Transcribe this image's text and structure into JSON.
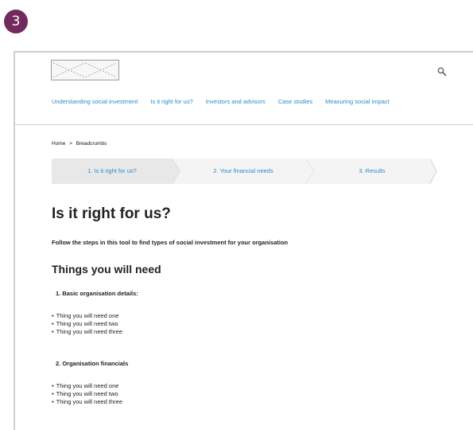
{
  "badge": {
    "number": "3",
    "color": "#722a5e"
  },
  "header": {
    "logo": "logo-placeholder",
    "search_icon": "search-icon"
  },
  "nav": {
    "items": [
      "Understanding social investment",
      "Is it right for us?",
      "Investors and advisors",
      "Case studies",
      "Measuring social impact"
    ]
  },
  "breadcrumb": {
    "home": "Home",
    "separator": ">",
    "current": "Breadcrumbs"
  },
  "stepper": {
    "steps": [
      {
        "label": "1. Is it right for us?",
        "active": true
      },
      {
        "label": "2. Your financial needs",
        "active": false
      },
      {
        "label": "3. Results",
        "active": false
      }
    ]
  },
  "main": {
    "title": "Is it right for us?",
    "intro": "Follow the steps in this tool to find types of social investment for your organisation",
    "section_title": "Things you will need",
    "groups": [
      {
        "title": "1.  Basic organisation details:",
        "items": [
          "Thing you will need one",
          "Thing you will need two",
          "Thing you will need three"
        ]
      },
      {
        "title": "2.  Organisation financials",
        "items": [
          "Thing you will need one",
          "Thing you will need two",
          "Thing you will need three"
        ]
      }
    ]
  },
  "colors": {
    "link": "#2a8cc8",
    "step_active_bg": "#e8e8e8"
  }
}
